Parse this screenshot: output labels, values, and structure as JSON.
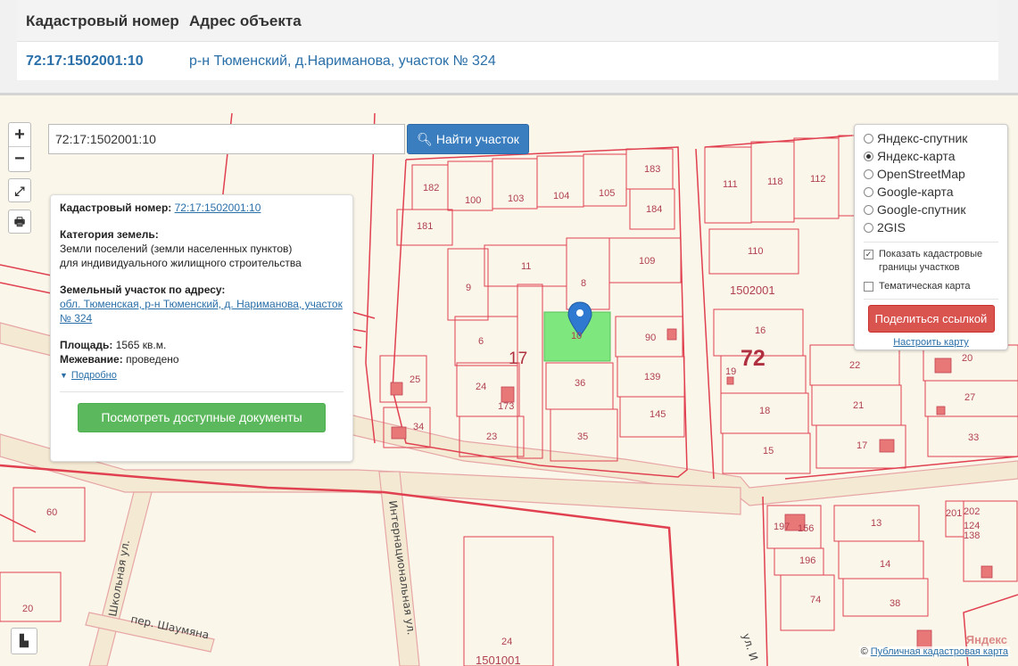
{
  "table": {
    "headers": [
      "Кадастровый номер",
      "Адрес объекта"
    ],
    "row": {
      "number": "72:17:1502001:10",
      "address": "р-н Тюменский, д.Нариманова, участок № 324"
    }
  },
  "controls": {
    "zoom_in": "+",
    "zoom_out": "−"
  },
  "search": {
    "value": "72:17:1502001:10",
    "button": "Найти участок"
  },
  "card": {
    "cadastral_label": "Кадастровый номер:",
    "cadastral_value": "72:17:1502001:10",
    "category_label": "Категория земель:",
    "category_value_1": "Земли поселений (земли населенных пунктов)",
    "category_value_2": "для индивидуального жилищного строительства",
    "address_label": "Земельный участок по адресу:",
    "address_value": "обл. Тюменская, р-н Тюменский, д. Нариманова, участок № 324",
    "area_label": "Площадь:",
    "area_value": "1565 кв.м.",
    "survey_label": "Межевание:",
    "survey_value": "проведено",
    "more": "Подробно",
    "docs_button": "Посмотреть доступные документы"
  },
  "layers": {
    "options": [
      "Яндекс-спутник",
      "Яндекс-карта",
      "OpenStreetMap",
      "Google-карта",
      "Google-спутник",
      "2GIS"
    ],
    "selected": "Яндекс-карта",
    "show_borders": "Показать кадастровые границы участков",
    "thematic": "Тематическая карта",
    "share_button": "Поделиться ссылкой",
    "configure": "Настроить карту"
  },
  "map": {
    "quarters": [
      "1502001",
      "1501001"
    ],
    "big_labels": [
      "17",
      "72"
    ],
    "streets": [
      "Школьная ул.",
      "Интернациональная ул.",
      "пер. Шаумяна",
      "ул. И"
    ],
    "parcels": [
      "182",
      "100",
      "103",
      "104",
      "105",
      "183",
      "184",
      "181",
      "11",
      "8",
      "109",
      "9",
      "6",
      "10",
      "90",
      "36",
      "139",
      "145",
      "24",
      "23",
      "35",
      "25",
      "34",
      "173",
      "111",
      "118",
      "112",
      "110",
      "16",
      "19",
      "18",
      "15",
      "22",
      "21",
      "17",
      "20",
      "27",
      "33",
      "60",
      "20",
      "197",
      "156",
      "196",
      "74",
      "13",
      "14",
      "38",
      "201",
      "202",
      "124",
      "138",
      "24"
    ],
    "copyright_link": "Публичная кадастровая карта",
    "copyright_prefix": "©",
    "yandex": "Яндекс"
  },
  "colors": {
    "selected_parcel": "#7ee87e",
    "boundary": "#e04050",
    "road_outline": "#d98a8a",
    "primary": "#3a7ec0",
    "success": "#5cb85c",
    "danger": "#d9534f"
  }
}
